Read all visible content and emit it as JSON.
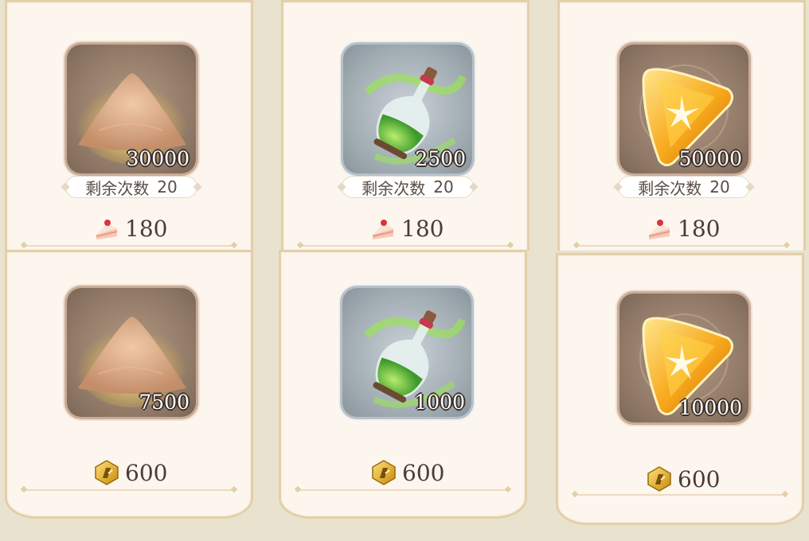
{
  "remaining_label": "剩余次数",
  "cards": [
    {
      "item": "sand-pile",
      "quantity": "30000",
      "remaining": "20",
      "currency": "cake",
      "price": "180"
    },
    {
      "item": "green-potion",
      "quantity": "2500",
      "remaining": "20",
      "currency": "cake",
      "price": "180"
    },
    {
      "item": "amber-crystal",
      "quantity": "50000",
      "remaining": "20",
      "currency": "cake",
      "price": "180"
    },
    {
      "item": "sand-pile",
      "quantity": "7500",
      "currency": "gold-coin",
      "price": "600"
    },
    {
      "item": "green-potion",
      "quantity": "1000",
      "currency": "gold-coin",
      "price": "600"
    },
    {
      "item": "amber-crystal",
      "quantity": "10000",
      "currency": "gold-coin",
      "price": "600"
    }
  ]
}
